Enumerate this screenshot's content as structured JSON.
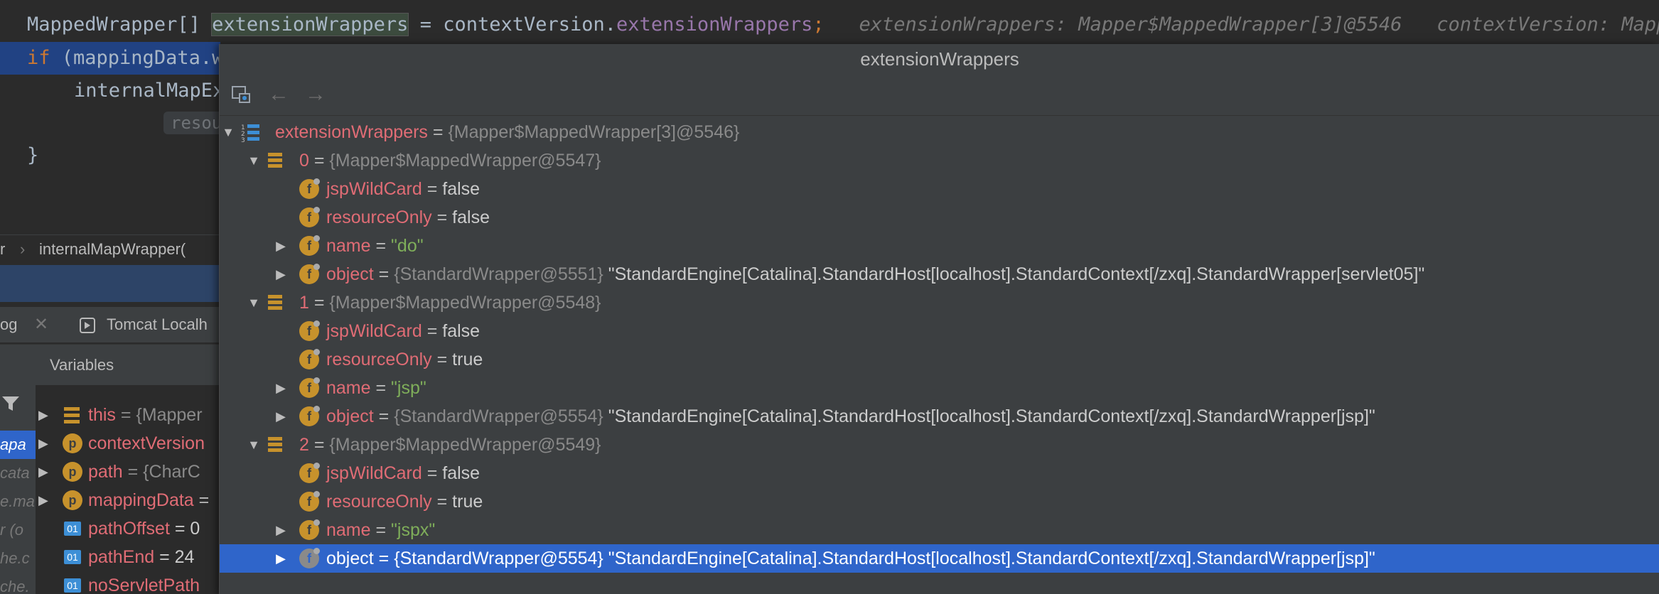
{
  "editor": {
    "line1": {
      "type": "MappedWrapper[] ",
      "var": "extensionWrappers",
      "mid": " = contextVersion.",
      "field": "extensionWrappers",
      "end": ";",
      "inlay1": "extensionWrappers: Mapper$MappedWrapper[3]@5546",
      "inlay2": "contextVersion: Mapper$"
    },
    "line2": {
      "kw": "if",
      "rest": " (mappingData.w"
    },
    "line3": {
      "text": "internalMapEx"
    },
    "line4": {
      "hint": "resou"
    },
    "line5": {
      "text": "}"
    }
  },
  "breadcrumb": {
    "left": "r",
    "sep": "›",
    "method": "internalMapWrapper("
  },
  "tool_tabs": {
    "debug": "og",
    "tomcat": "Tomcat Localh"
  },
  "variables_panel": {
    "title": "Variables",
    "frames": [
      "apa",
      "cata",
      "e.ma",
      "r (o",
      "he.c",
      "che."
    ],
    "items": [
      {
        "name": "this",
        "rest": " = {Mapper",
        "icon": "object-icon"
      },
      {
        "name": "contextVersion",
        "rest": "",
        "icon": "param-icon"
      },
      {
        "name": "path",
        "rest": " = {CharC",
        "icon": "param-icon"
      },
      {
        "name": "mappingData",
        "rest": " =",
        "icon": "param-icon"
      },
      {
        "name": "pathOffset",
        "rest": " = 0",
        "icon": "local-icon"
      },
      {
        "name": "pathEnd",
        "rest": " = 24",
        "icon": "local-icon"
      },
      {
        "name": "noServletPath",
        "rest": "",
        "icon": "local-icon"
      }
    ]
  },
  "popup": {
    "title": "extensionWrappers",
    "root": {
      "name": "extensionWrappers",
      "eq": " = ",
      "type": "{Mapper$MappedWrapper[3]@5546}"
    },
    "entries": [
      {
        "index": "0",
        "type": "{Mapper$MappedWrapper@5547}",
        "fields": [
          {
            "name": "jspWildCard",
            "value": "false",
            "kind": "bool",
            "expandable": false
          },
          {
            "name": "resourceOnly",
            "value": "false",
            "kind": "bool",
            "expandable": false
          },
          {
            "name": "name",
            "value": "\"do\"",
            "kind": "str",
            "expandable": true
          },
          {
            "name": "object",
            "type": "{StandardWrapper@5551}",
            "value": "\"StandardEngine[Catalina].StandardHost[localhost].StandardContext[/zxq].StandardWrapper[servlet05]\"",
            "kind": "obj",
            "expandable": true
          }
        ]
      },
      {
        "index": "1",
        "type": "{Mapper$MappedWrapper@5548}",
        "fields": [
          {
            "name": "jspWildCard",
            "value": "false",
            "kind": "bool",
            "expandable": false
          },
          {
            "name": "resourceOnly",
            "value": "true",
            "kind": "bool",
            "expandable": false
          },
          {
            "name": "name",
            "value": "\"jsp\"",
            "kind": "str",
            "expandable": true
          },
          {
            "name": "object",
            "type": "{StandardWrapper@5554}",
            "value": "\"StandardEngine[Catalina].StandardHost[localhost].StandardContext[/zxq].StandardWrapper[jsp]\"",
            "kind": "obj",
            "expandable": true
          }
        ]
      },
      {
        "index": "2",
        "type": "{Mapper$MappedWrapper@5549}",
        "fields": [
          {
            "name": "jspWildCard",
            "value": "false",
            "kind": "bool",
            "expandable": false
          },
          {
            "name": "resourceOnly",
            "value": "true",
            "kind": "bool",
            "expandable": false
          },
          {
            "name": "name",
            "value": "\"jspx\"",
            "kind": "str",
            "expandable": true
          },
          {
            "name": "object",
            "type": "{StandardWrapper@5554}",
            "value": "\"StandardEngine[Catalina].StandardHost[localhost].StandardContext[/zxq].StandardWrapper[jsp]\"",
            "kind": "obj",
            "expandable": true,
            "selected": true
          }
        ]
      }
    ]
  },
  "colors": {
    "selection": "#2f65ca",
    "field_name": "#e06c75",
    "string": "#7fae5a",
    "editor_bg": "#2b2b2b",
    "panel_bg": "#3c3f41"
  }
}
